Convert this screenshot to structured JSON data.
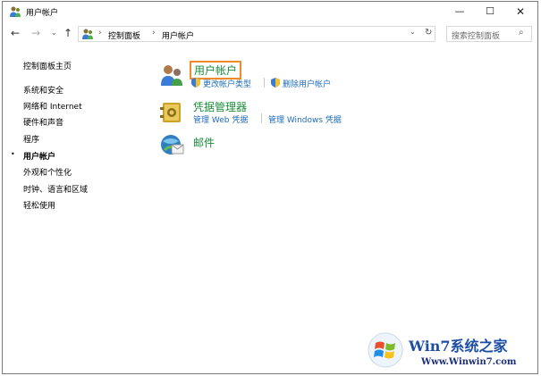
{
  "window": {
    "title": "用户帐户"
  },
  "titlebar": {
    "minimize": "—",
    "maximize": "☐",
    "close": "✕"
  },
  "nav": {
    "back": "←",
    "forward": "→",
    "recent": "⌄",
    "up": "↑"
  },
  "address": {
    "separator": "›",
    "crumbs": [
      "控制面板",
      "用户帐户"
    ],
    "dropdown": "⌄",
    "refresh": "↻"
  },
  "search": {
    "placeholder": "搜索控制面板",
    "icon": "⌕"
  },
  "sidebar": {
    "bullet": "•",
    "items": [
      {
        "label": "控制面板主页"
      },
      {
        "label": "系统和安全"
      },
      {
        "label": "网络和 Internet"
      },
      {
        "label": "硬件和声音"
      },
      {
        "label": "程序"
      },
      {
        "label": "用户帐户",
        "active": true
      },
      {
        "label": "外观和个性化"
      },
      {
        "label": "时钟、语言和区域"
      },
      {
        "label": "轻松使用"
      }
    ]
  },
  "categories": [
    {
      "title": "用户帐户",
      "links": [
        "更改帐户类型",
        "删除用户帐户"
      ]
    },
    {
      "title": "凭据管理器",
      "links": [
        "管理 Web 凭据",
        "管理 Windows 凭据"
      ]
    },
    {
      "title": "邮件",
      "links": []
    }
  ],
  "watermark": {
    "title": "Win7系统之家",
    "url": "Www.Winwin7.com"
  },
  "colors": {
    "link": "#1e6bb8",
    "category": "#1a8c3a",
    "highlight": "#f08a2b"
  }
}
